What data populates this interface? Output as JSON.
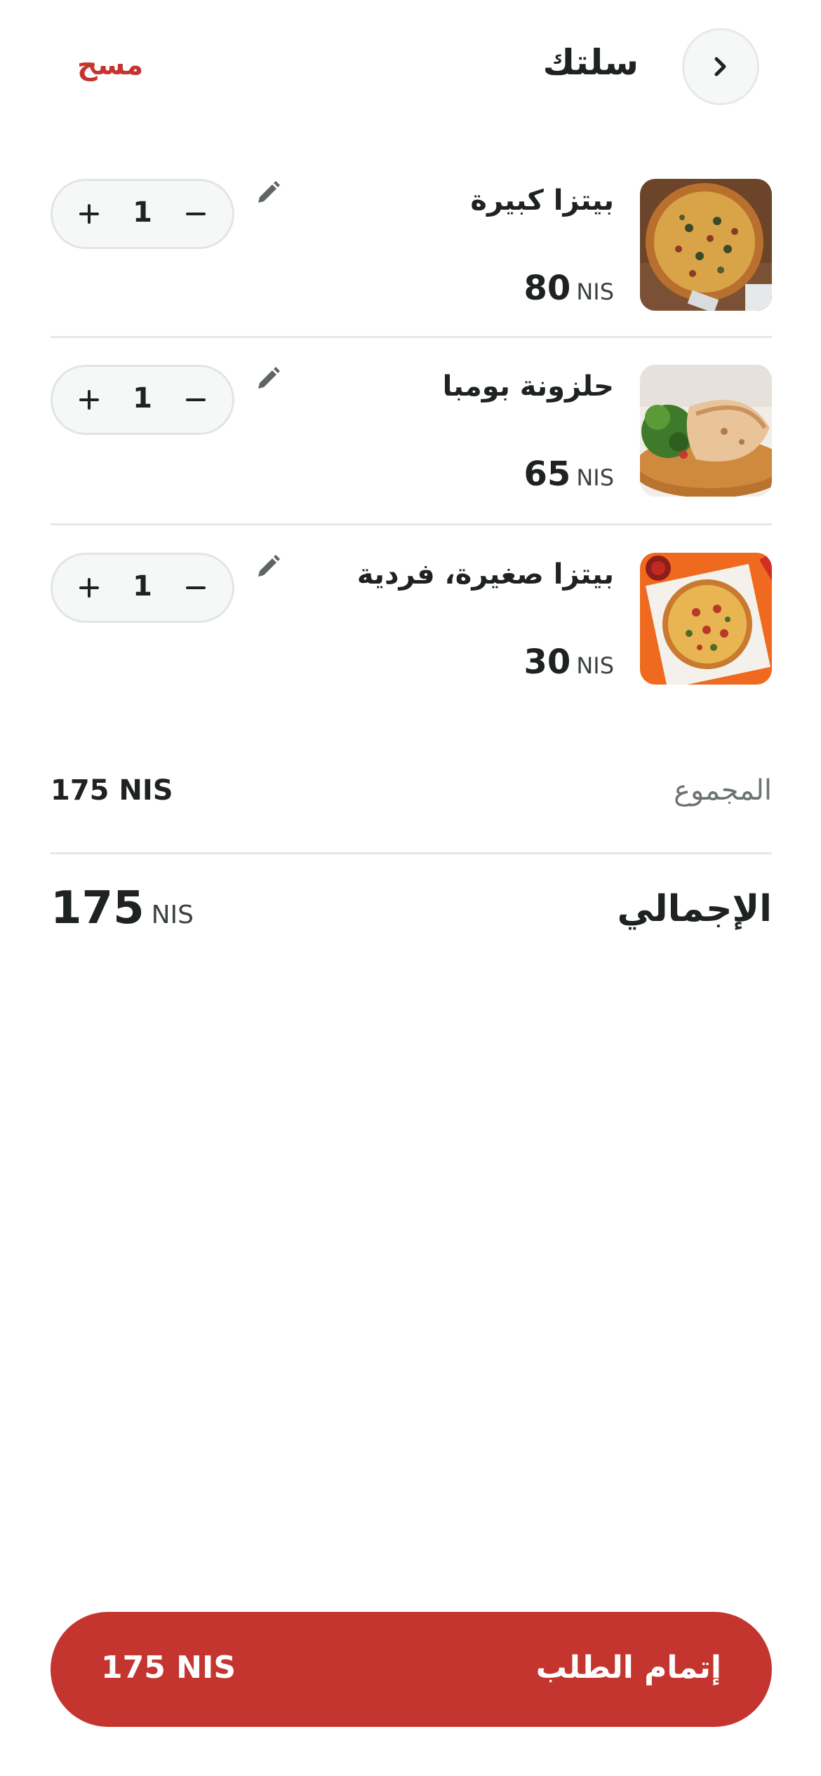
{
  "header": {
    "title": "سلتك",
    "clear_label": "مسح",
    "back_icon": "chevron-right-icon"
  },
  "cart": {
    "items": [
      {
        "name": "بيتزا كبيرة",
        "price": "80",
        "currency": "NIS",
        "quantity": "1",
        "image": "large-pizza-photo"
      },
      {
        "name": "حلزونة بومبا",
        "price": "65",
        "currency": "NIS",
        "quantity": "1",
        "image": "calzone-photo"
      },
      {
        "name": "بيتزا صغيرة، فردية",
        "price": "30",
        "currency": "NIS",
        "quantity": "1",
        "image": "small-pizza-photo"
      }
    ]
  },
  "summary": {
    "subtotal_label": "المجموع",
    "subtotal_value": "175 NIS",
    "total_label": "الإجمالي",
    "total_value": "175",
    "total_currency": "NIS"
  },
  "checkout": {
    "label": "إتمام الطلب",
    "price": "175 NIS"
  },
  "colors": {
    "accent": "#c4352f",
    "text": "#1f2222",
    "muted": "#6d7373",
    "divider": "#e6e8e8"
  }
}
